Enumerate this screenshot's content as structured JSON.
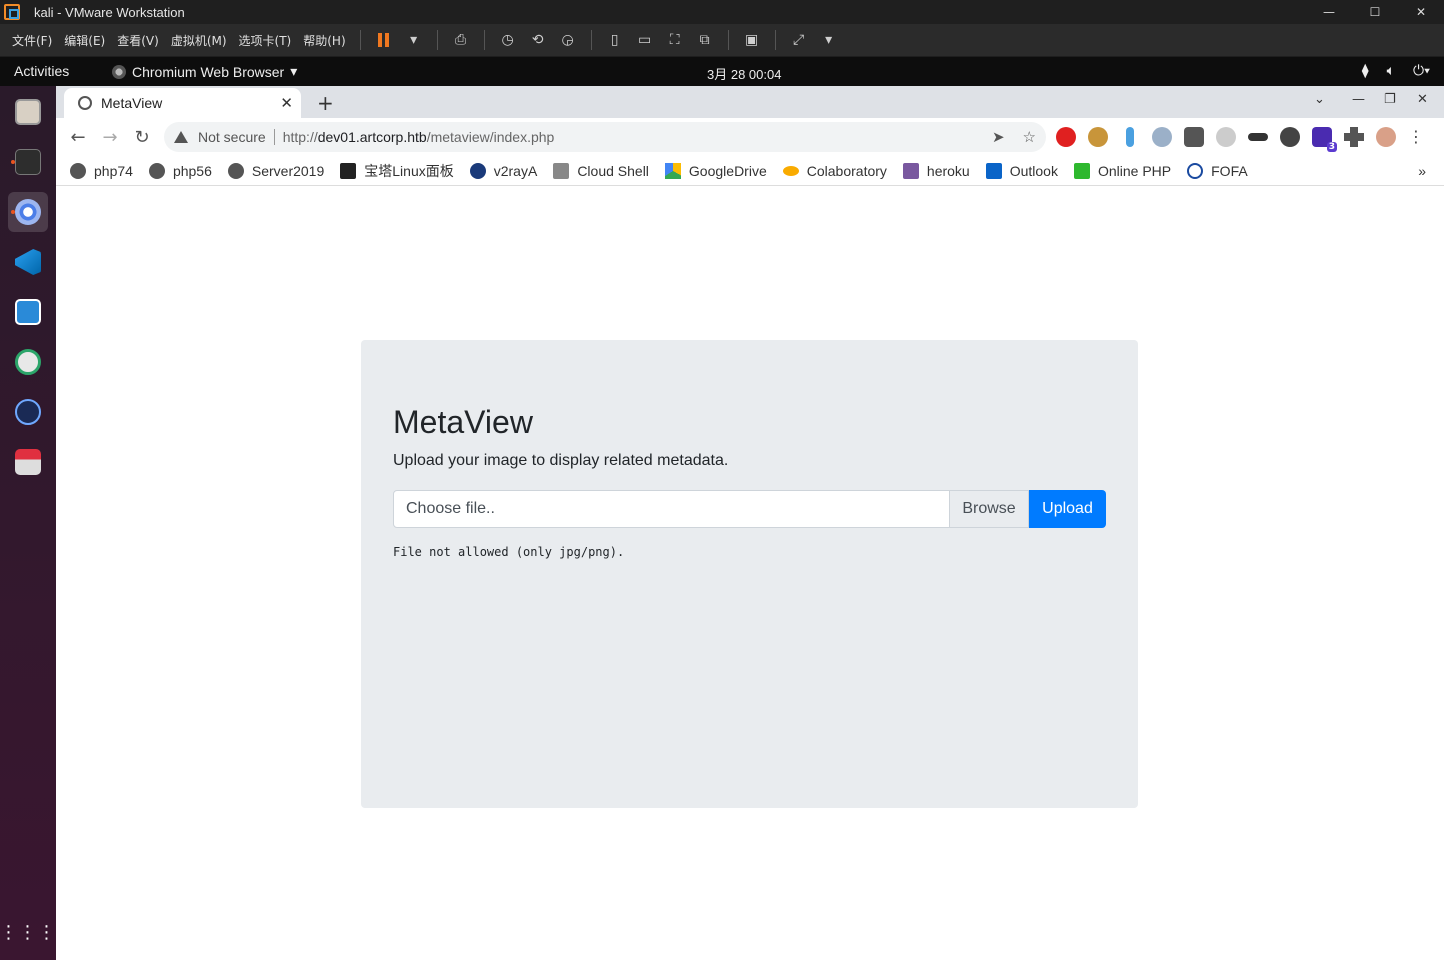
{
  "vmware": {
    "title": "kali - VMware Workstation",
    "menu": [
      "文件(F)",
      "编辑(E)",
      "查看(V)",
      "虚拟机(M)",
      "选项卡(T)",
      "帮助(H)"
    ]
  },
  "gnome": {
    "activities": "Activities",
    "app_name": "Chromium Web Browser",
    "clock": "3月 28  00:04"
  },
  "browser": {
    "tab_title": "MetaView",
    "not_secure": "Not secure",
    "url_prefix": "http://",
    "url_host": "dev01.artcorp.htb",
    "url_path": "/metaview/index.php",
    "bookmarks": [
      "php74",
      "php56",
      "Server2019",
      "宝塔Linux面板",
      "v2rayA",
      "Cloud Shell",
      "GoogleDrive",
      "Colaboratory",
      "heroku",
      "Outlook",
      "Online PHP",
      "FOFA"
    ],
    "extension_badge": "3"
  },
  "page": {
    "heading": "MetaView",
    "lead": "Upload your image to display related metadata.",
    "file_placeholder": "Choose file..",
    "browse_label": "Browse",
    "upload_label": "Upload",
    "message": "File not allowed (only jpg/png)."
  },
  "colors": {
    "primary": "#007bff",
    "card_bg": "#e9ecef",
    "ubuntu_orange": "#e95420"
  }
}
